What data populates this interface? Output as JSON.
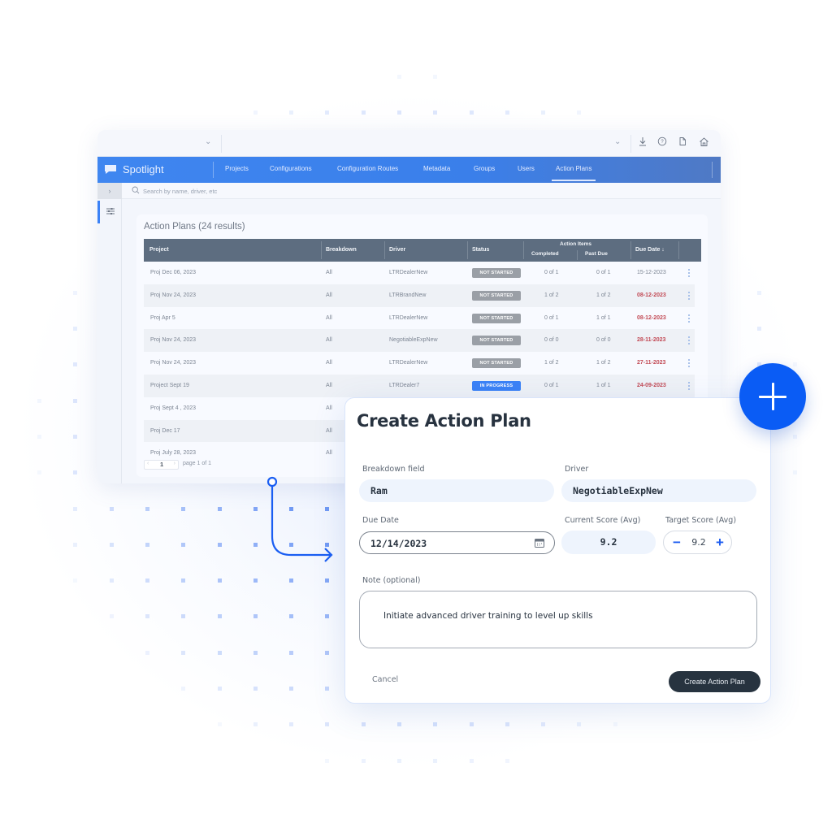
{
  "app": {
    "brand": "Spotlight",
    "search_placeholder": "Search by name, driver, etc",
    "nav": [
      {
        "label": "Projects",
        "active": false
      },
      {
        "label": "Configurations",
        "active": false
      },
      {
        "label": "Configuration Routes",
        "active": false
      },
      {
        "label": "Metadata",
        "active": false
      },
      {
        "label": "Groups",
        "active": false
      },
      {
        "label": "Users",
        "active": false
      },
      {
        "label": "Action Plans",
        "active": true
      }
    ],
    "toolbar_icons": [
      "download-icon",
      "help-icon",
      "document-icon",
      "home-icon"
    ]
  },
  "table": {
    "title": "Action Plans (24 results)",
    "headers": {
      "project": "Project",
      "breakdown": "Breakdown",
      "driver": "Driver",
      "status": "Status",
      "action_items": "Action Items",
      "completed": "Completed",
      "past_due": "Past Due",
      "due_date": "Due Date ↓"
    },
    "rows": [
      {
        "project": "Proj Dec 06, 2023",
        "breakdown": "All",
        "driver": "LTRDealerNew",
        "status": "NOT STARTED",
        "status_type": "not-started",
        "completed": "0 of 1",
        "past_due": "0 of 1",
        "due_date": "15-12-2023",
        "overdue": false
      },
      {
        "project": "Proj Nov 24, 2023",
        "breakdown": "All",
        "driver": "LTRBrandNew",
        "status": "NOT STARTED",
        "status_type": "not-started",
        "completed": "1 of 2",
        "past_due": "1 of 2",
        "due_date": "08-12-2023",
        "overdue": true
      },
      {
        "project": "Proj Apr 5",
        "breakdown": "All",
        "driver": "LTRDealerNew",
        "status": "NOT STARTED",
        "status_type": "not-started",
        "completed": "0 of 1",
        "past_due": "1 of 1",
        "due_date": "08-12-2023",
        "overdue": true
      },
      {
        "project": "Proj Nov 24, 2023",
        "breakdown": "All",
        "driver": "NegotiableExpNew",
        "status": "NOT STARTED",
        "status_type": "not-started",
        "completed": "0 of 0",
        "past_due": "0 of 0",
        "due_date": "28-11-2023",
        "overdue": true
      },
      {
        "project": "Proj Nov 24, 2023",
        "breakdown": "All",
        "driver": "LTRDealerNew",
        "status": "NOT STARTED",
        "status_type": "not-started",
        "completed": "1 of 2",
        "past_due": "1 of 2",
        "due_date": "27-11-2023",
        "overdue": true
      },
      {
        "project": "Project Sept 19",
        "breakdown": "All",
        "driver": "LTRDealer7",
        "status": "IN PROGRESS",
        "status_type": "in-progress",
        "completed": "0 of 1",
        "past_due": "1 of 1",
        "due_date": "24-09-2023",
        "overdue": true
      },
      {
        "project": "Proj Sept 4 , 2023",
        "breakdown": "All"
      },
      {
        "project": "Proj Dec 17",
        "breakdown": "All"
      },
      {
        "project": "Proj July 28, 2023",
        "breakdown": "All"
      }
    ],
    "pagination": {
      "current": "1",
      "label": "page 1 of 1"
    }
  },
  "modal": {
    "title": "Create Action Plan",
    "breakdown_label": "Breakdown field",
    "breakdown_value": "Ram",
    "driver_label": "Driver",
    "driver_value": "NegotiableExpNew",
    "due_date_label": "Due Date",
    "due_date_value": "12/14/2023",
    "current_score_label": "Current Score (Avg)",
    "current_score_value": "9.2",
    "target_score_label": "Target Score (Avg)",
    "target_score_value": "9.2",
    "note_label": "Note (optional)",
    "note_value": "Initiate advanced driver training to level up skills",
    "cancel_label": "Cancel",
    "submit_label": "Create Action Plan"
  },
  "colors": {
    "accent": "#0a5cf5",
    "navbar": "#3f86f0",
    "table_header": "#5d6d80",
    "overdue": "#c24a55",
    "badge_not_started": "#9a9fa6",
    "badge_in_progress": "#3b82f6",
    "submit_button": "#27333f"
  }
}
